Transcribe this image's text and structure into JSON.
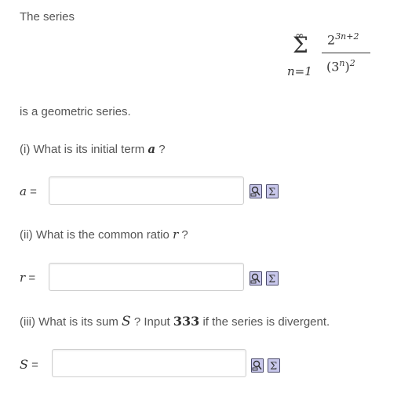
{
  "intro": "The series",
  "formula": {
    "upper": "∞",
    "sigma": "Σ",
    "lower": "n=1",
    "numerator_base": "2",
    "numerator_exp": "3n+2",
    "denominator_base": "(3",
    "denominator_inner_exp": "n",
    "denominator_close": ")",
    "denominator_exp": "2"
  },
  "statement": "is a geometric series.",
  "q1": {
    "prefix": "(i) What is its initial term ",
    "var": "a",
    "suffix": " ?",
    "label_var": "a",
    "label_eq": " ="
  },
  "q2": {
    "prefix": "(ii) What is the common ratio ",
    "var": "r",
    "suffix": " ?",
    "label_var": "r",
    "label_eq": " ="
  },
  "q3": {
    "prefix": "(iii) What is its sum ",
    "var": "S",
    "mid": " ? Input ",
    "bold": "333",
    "suffix": " if the series is divergent.",
    "label_var": "S",
    "label_eq": " ="
  },
  "inputs": {
    "a_value": "",
    "r_value": "",
    "s_value": ""
  },
  "icons": [
    "preview-icon",
    "sigma-equation-icon"
  ]
}
